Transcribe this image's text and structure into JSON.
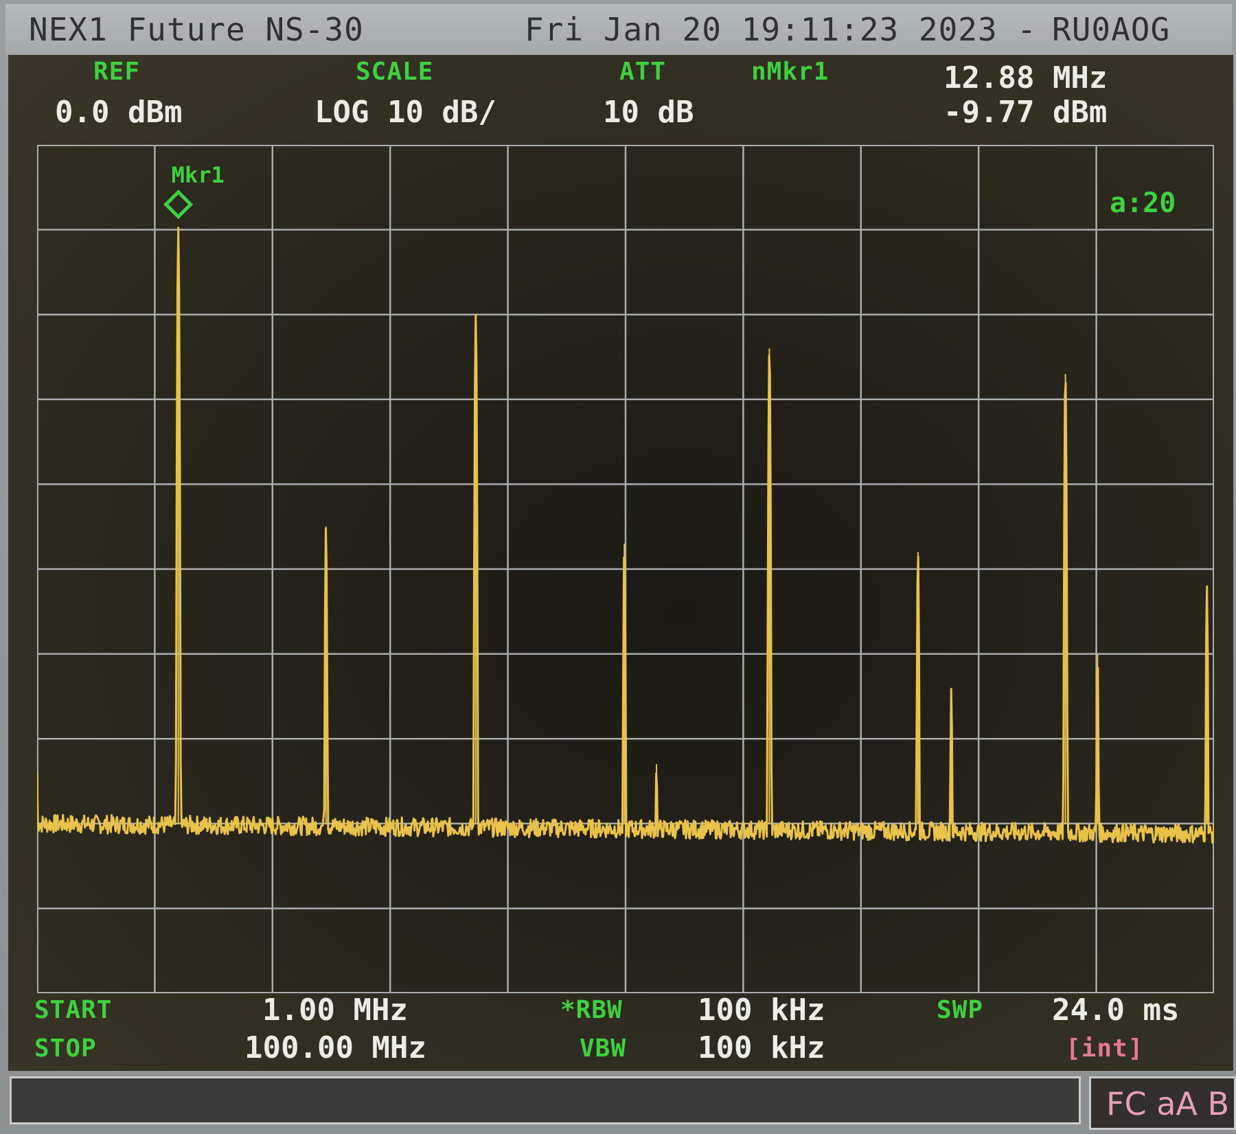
{
  "titlebar": {
    "device": "NEX1 Future NS-30",
    "datetime": "Fri Jan 20 19:11:23 2023 -",
    "callsign": "RU0AOG"
  },
  "header": {
    "ref_label": "REF",
    "ref_value": "0.0 dBm",
    "scale_label": "SCALE",
    "scale_value": "LOG 10 dB/",
    "att_label": "ATT",
    "att_value": "10 dB",
    "marker_label": "nMkr1",
    "marker_freq": "12.88 MHz",
    "marker_level": "-9.77 dBm"
  },
  "plot": {
    "marker_tag": "Mkr1",
    "avg_label": "a:20"
  },
  "footer": {
    "start_label": "START",
    "start_value": "1.00 MHz",
    "stop_label": "STOP",
    "stop_value": "100.00 MHz",
    "rbw_label": "*RBW",
    "rbw_value": "100 kHz",
    "vbw_label": "VBW",
    "vbw_value": "100 kHz",
    "swp_label": "SWP",
    "swp_value": "24.0 ms",
    "swp_mode": "[int]"
  },
  "annotation": "FC aA B",
  "colors": {
    "trace": "#e8c24a",
    "grid": "#a9adad",
    "label_green": "#3fd13f",
    "value_white": "#ecece6",
    "mode_pink": "#e6a0b4"
  },
  "chart_data": {
    "type": "line",
    "xlabel": "",
    "ylabel": "",
    "xlim": [
      1.0,
      100.0
    ],
    "ylim": [
      -100,
      0
    ],
    "grid": true,
    "noise_floor_dbm": -80,
    "marker": {
      "freq_mhz": 12.88,
      "level_dbm": -9.77
    },
    "peaks": [
      {
        "freq_mhz": 1.0,
        "level_dbm": -74
      },
      {
        "freq_mhz": 12.88,
        "level_dbm": -9.77
      },
      {
        "freq_mhz": 25.3,
        "level_dbm": -45
      },
      {
        "freq_mhz": 37.9,
        "level_dbm": -20
      },
      {
        "freq_mhz": 50.4,
        "level_dbm": -47
      },
      {
        "freq_mhz": 53.1,
        "level_dbm": -73
      },
      {
        "freq_mhz": 62.6,
        "level_dbm": -24
      },
      {
        "freq_mhz": 75.1,
        "level_dbm": -48
      },
      {
        "freq_mhz": 77.9,
        "level_dbm": -64
      },
      {
        "freq_mhz": 87.5,
        "level_dbm": -27
      },
      {
        "freq_mhz": 90.2,
        "level_dbm": -60
      },
      {
        "freq_mhz": 99.4,
        "level_dbm": -52
      }
    ]
  }
}
